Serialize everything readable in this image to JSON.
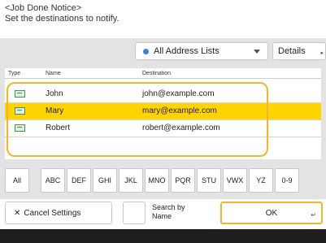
{
  "header": {
    "line1": "<Job Done Notice>",
    "line2": "Set the destinations to notify."
  },
  "address_list": {
    "label": "All Address Lists"
  },
  "details_button": "Details",
  "table": {
    "columns": [
      "Type",
      "Name",
      "Destination"
    ],
    "rows": [
      {
        "name": "John",
        "destination": "john@example.com",
        "selected": false
      },
      {
        "name": "Mary",
        "destination": "mary@example.com",
        "selected": true
      },
      {
        "name": "Robert",
        "destination": "robert@example.com",
        "selected": false
      }
    ]
  },
  "alphabet_keys": [
    "All",
    "ABC",
    "DEF",
    "GHI",
    "JKL",
    "MNO",
    "PQR",
    "STU",
    "VWX",
    "YZ",
    "0-9"
  ],
  "buttons": {
    "cancel": "Cancel Settings",
    "search_by_name": [
      "Search by",
      "Name"
    ],
    "ok": "OK"
  },
  "colors": {
    "selection": "#ffd400",
    "highlight": "#f1b531"
  }
}
